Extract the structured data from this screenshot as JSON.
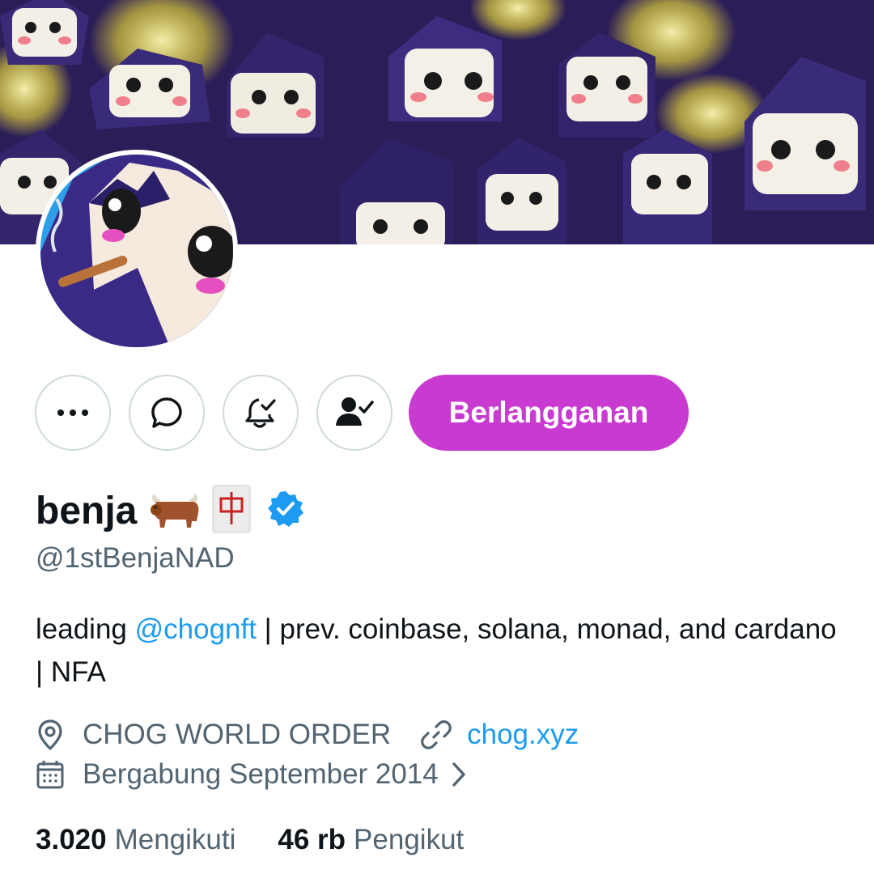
{
  "profile": {
    "display_name": "benja",
    "name_emojis": [
      "ox-emoji",
      "mahjong-red-dragon-emoji"
    ],
    "verified": true,
    "handle": "@1stBenjaNAD",
    "bio": {
      "prefix": "leading ",
      "mention": "@chognft",
      "suffix": " | prev. coinbase, solana, monad, and cardano | NFA"
    },
    "location": "CHOG WORLD ORDER",
    "website": "chog.xyz",
    "joined": "Bergabung September 2014"
  },
  "actions": {
    "more_icon": "more-icon",
    "message_icon": "message-icon",
    "notifications_icon": "bell-check-icon",
    "following_icon": "person-check-icon",
    "subscribe_label": "Berlangganan"
  },
  "stats": {
    "following_count": "3.020",
    "following_label": "Mengikuti",
    "followers_count": "46 rb",
    "followers_label": "Pengikut"
  },
  "colors": {
    "accent": "#1d9bf0",
    "subscribe": "#c93ad0",
    "secondary_text": "#536471",
    "border": "#cfd9de",
    "banner_bg": "#2d1f5a"
  }
}
